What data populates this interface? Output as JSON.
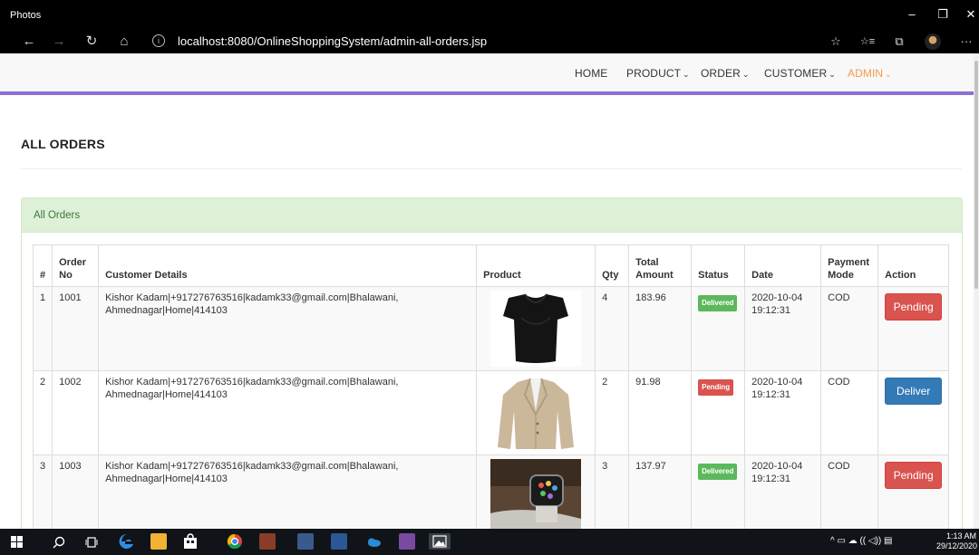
{
  "window": {
    "title": "Photos",
    "controls": [
      "–",
      "❐",
      "✕"
    ]
  },
  "browser": {
    "url_host": "localhost",
    "url_rest": ":8080/OnlineShoppingSystem/admin-all-orders.jsp",
    "back_glyph": "←",
    "forward_glyph": "→",
    "refresh_glyph": "↻",
    "home_glyph": "⌂",
    "info_glyph": "i",
    "star_glyph": "☆",
    "favorites_glyph": "☆≡",
    "share_glyph": "⧉",
    "more_glyph": "···"
  },
  "nav": {
    "items": [
      {
        "label": "HOME",
        "caret": ""
      },
      {
        "label": "PRODUCT",
        "caret": "⌄"
      },
      {
        "label": "ORDER",
        "caret": "⌄"
      },
      {
        "label": "CUSTOMER",
        "caret": "⌄"
      },
      {
        "label": "ADMIN",
        "caret": "⌄"
      }
    ],
    "active_color": "#f39c4a",
    "border_color": "#8e6fd6"
  },
  "page": {
    "title": "ALL ORDERS",
    "panel_heading": "All Orders"
  },
  "table": {
    "headers": {
      "num": "#",
      "order_no": "Order No",
      "customer": "Customer Details",
      "product": "Product",
      "qty": "Qty",
      "total": "Total Amount",
      "status": "Status",
      "date": "Date",
      "payment": "Payment Mode",
      "action": "Action"
    },
    "rows": [
      {
        "num": "1",
        "order_no": "1001",
        "customer_line1": "Kishor Kadam|+917276763516|kadamk33@gmail.com|Bhalawani,",
        "customer_line2": "Ahmednagar|Home|414103",
        "product_icon": "black-top-image",
        "qty": "4",
        "total": "183.96",
        "status": "Delivered",
        "date_line1": "2020-10-04",
        "date_line2": "19:12:31",
        "payment": "COD",
        "action": "Pending"
      },
      {
        "num": "2",
        "order_no": "1002",
        "customer_line1": "Kishor Kadam|+917276763516|kadamk33@gmail.com|Bhalawani,",
        "customer_line2": "Ahmednagar|Home|414103",
        "product_icon": "beige-blazer-image",
        "qty": "2",
        "total": "91.98",
        "status": "Pending",
        "date_line1": "2020-10-04",
        "date_line2": "19:12:31",
        "payment": "COD",
        "action": "Deliver"
      },
      {
        "num": "3",
        "order_no": "1003",
        "customer_line1": "Kishor Kadam|+917276763516|kadamk33@gmail.com|Bhalawani,",
        "customer_line2": "Ahmednagar|Home|414103",
        "product_icon": "smartwatch-image",
        "qty": "3",
        "total": "137.97",
        "status": "Delivered",
        "date_line1": "2020-10-04",
        "date_line2": "19:12:31",
        "payment": "COD",
        "action": "Pending"
      }
    ]
  },
  "taskbar": {
    "time": "1:13 AM",
    "date": "29/12/2020",
    "tray_glyphs": "^  ▭  ☁  ((  ◁))  ▤"
  },
  "colors": {
    "success": "#5cb85c",
    "danger": "#d9534f",
    "primary": "#337ab7",
    "panel_bg": "#dff0d8"
  }
}
